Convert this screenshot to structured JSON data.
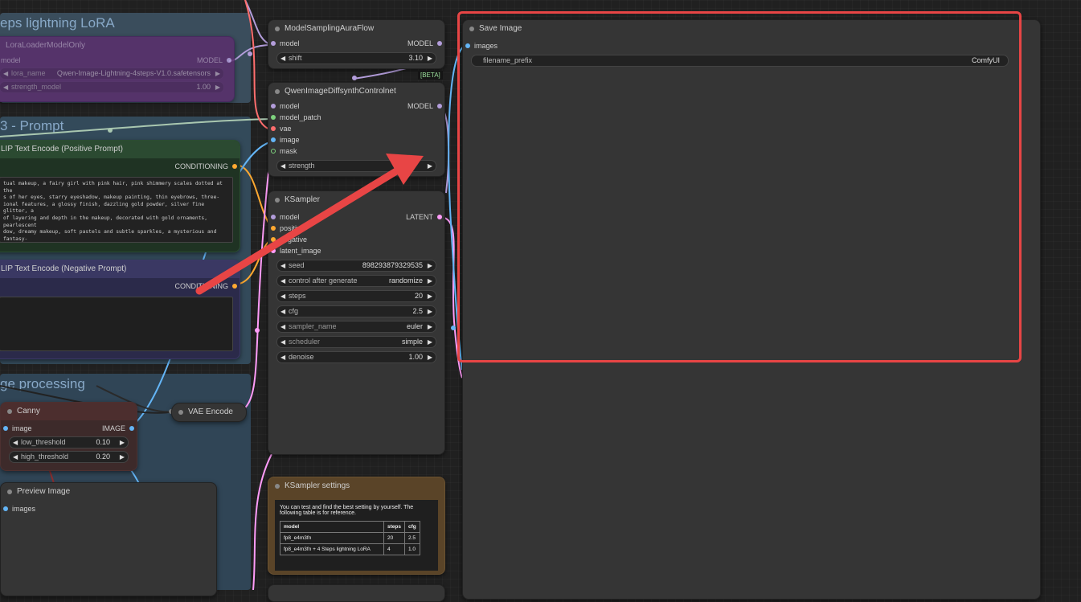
{
  "groups": {
    "lora": {
      "title": "eps lightning LoRA"
    },
    "prompt": {
      "title": "3 - Prompt"
    },
    "image_processing": {
      "title": "ge processing"
    }
  },
  "nodes": {
    "lora_loader": {
      "title": "LoraLoaderModelOnly",
      "input_model": "model",
      "output_model": "MODEL",
      "lora_name_label": "lora_name",
      "lora_name_value": "Qwen-Image-Lightning-4steps-V1.0.safetensors",
      "strength_label": "strength_model",
      "strength_value": "1.00"
    },
    "model_sampling": {
      "title": "ModelSamplingAuraFlow",
      "input_model": "model",
      "output_model": "MODEL",
      "shift_label": "shift",
      "shift_value": "3.10"
    },
    "beta_badge": "[BETA]",
    "controlnet": {
      "title": "QwenImageDiffsynthControlnet",
      "inputs": [
        "model",
        "model_patch",
        "vae",
        "image",
        "mask"
      ],
      "output_model": "MODEL",
      "strength_label": "strength"
    },
    "positive": {
      "title": "LIP Text Encode (Positive Prompt)",
      "output": "CONDITIONING",
      "text": "tual makeup, a fairy girl with pink hair, pink shimmery scales dotted at the\ns of her eyes, starry eyeshadow, makeup painting, thin eyebrows, three-\nional features, a glossy finish, dazzling gold powder, silver fine glitter, a\nof layering and depth in the makeup, decorated with gold ornaments, pearlescent\ndow, dreamy makeup, soft pastels and subtle sparkles, a mysterious and fantasy-\n atmosphere, high-end makeup, dappled light on the face, soft lighting, optimal\no, complex depth of field, dramatic lighting, clear focus, 8k, high quality,\nlm filter, surreal, a dreamy pastel wonderland, bright colors, a starry pink\nound, realistic."
    },
    "negative": {
      "title": "LIP Text Encode (Negative Prompt)",
      "output": "CONDITIONING"
    },
    "ksampler": {
      "title": "KSampler",
      "inputs": [
        "model",
        "positive",
        "negative",
        "latent_image"
      ],
      "output": "LATENT",
      "widgets": [
        {
          "label": "seed",
          "value": "898293879329535"
        },
        {
          "label": "control after generate",
          "value": "randomize"
        },
        {
          "label": "steps",
          "value": "20"
        },
        {
          "label": "cfg",
          "value": "2.5"
        },
        {
          "label": "sampler_name",
          "value": "euler"
        },
        {
          "label": "scheduler",
          "value": "simple"
        },
        {
          "label": "denoise",
          "value": "1.00"
        }
      ]
    },
    "save_image": {
      "title": "Save Image",
      "input": "images",
      "filename_label": "filename_prefix",
      "filename_value": "ComfyUI"
    },
    "canny": {
      "title": "Canny",
      "input": "image",
      "output": "IMAGE",
      "low_label": "low_threshold",
      "low_value": "0.10",
      "high_label": "high_threshold",
      "high_value": "0.20"
    },
    "vae_encode": {
      "title": "VAE Encode"
    },
    "preview": {
      "title": "Preview Image",
      "input": "images"
    },
    "note": {
      "title": "KSampler settings",
      "text": "You can test and find the best setting by yourself. The following table is for reference.",
      "headers": [
        "model",
        "steps",
        "cfg"
      ],
      "rows": [
        [
          "fp8_e4m3fn",
          "20",
          "2.5"
        ],
        [
          "fp8_e4m3fn + 4 Steps lightning LoRA",
          "4",
          "1.0"
        ]
      ]
    }
  },
  "colors": {
    "model": "#b39ddb",
    "conditioning": "#ffa931",
    "image": "#64b5f6",
    "vae": "#ff6e6e",
    "latent": "#ff9cf9",
    "patch": "#7ed37e",
    "highlight": "#e84545"
  }
}
